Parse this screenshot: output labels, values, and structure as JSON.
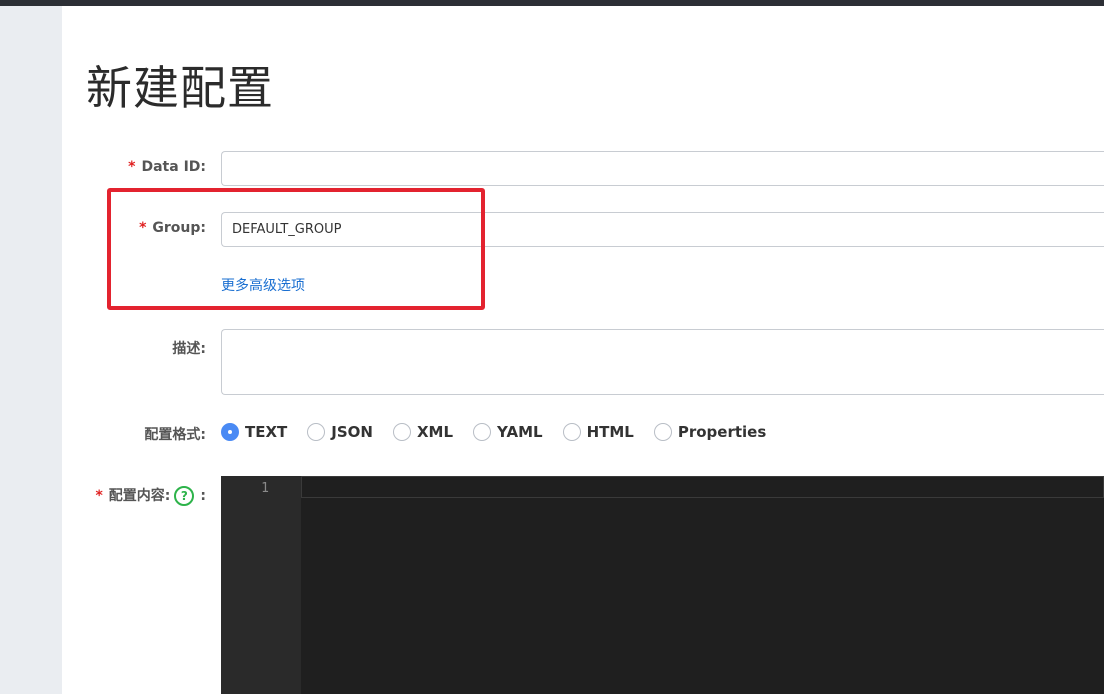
{
  "page": {
    "title": "新建配置"
  },
  "form": {
    "data_id": {
      "required_mark": "*",
      "label": "Data ID:",
      "value": ""
    },
    "group": {
      "required_mark": "*",
      "label": "Group:",
      "value": "DEFAULT_GROUP"
    },
    "advanced_link": "更多高级选项",
    "description": {
      "label": "描述:",
      "value": ""
    },
    "format": {
      "label": "配置格式:",
      "selected": "TEXT",
      "options": [
        "TEXT",
        "JSON",
        "XML",
        "YAML",
        "HTML",
        "Properties"
      ]
    },
    "content": {
      "required_mark": "*",
      "label": "配置内容:",
      "help_glyph": "?",
      "suffix": ":",
      "line_numbers": [
        "1"
      ]
    }
  },
  "colors": {
    "accent": "#4a8af4",
    "link": "#1a6fd1",
    "required": "#e02020",
    "highlight_box": "#e3232f",
    "editor_bg": "#1f1f1f"
  }
}
